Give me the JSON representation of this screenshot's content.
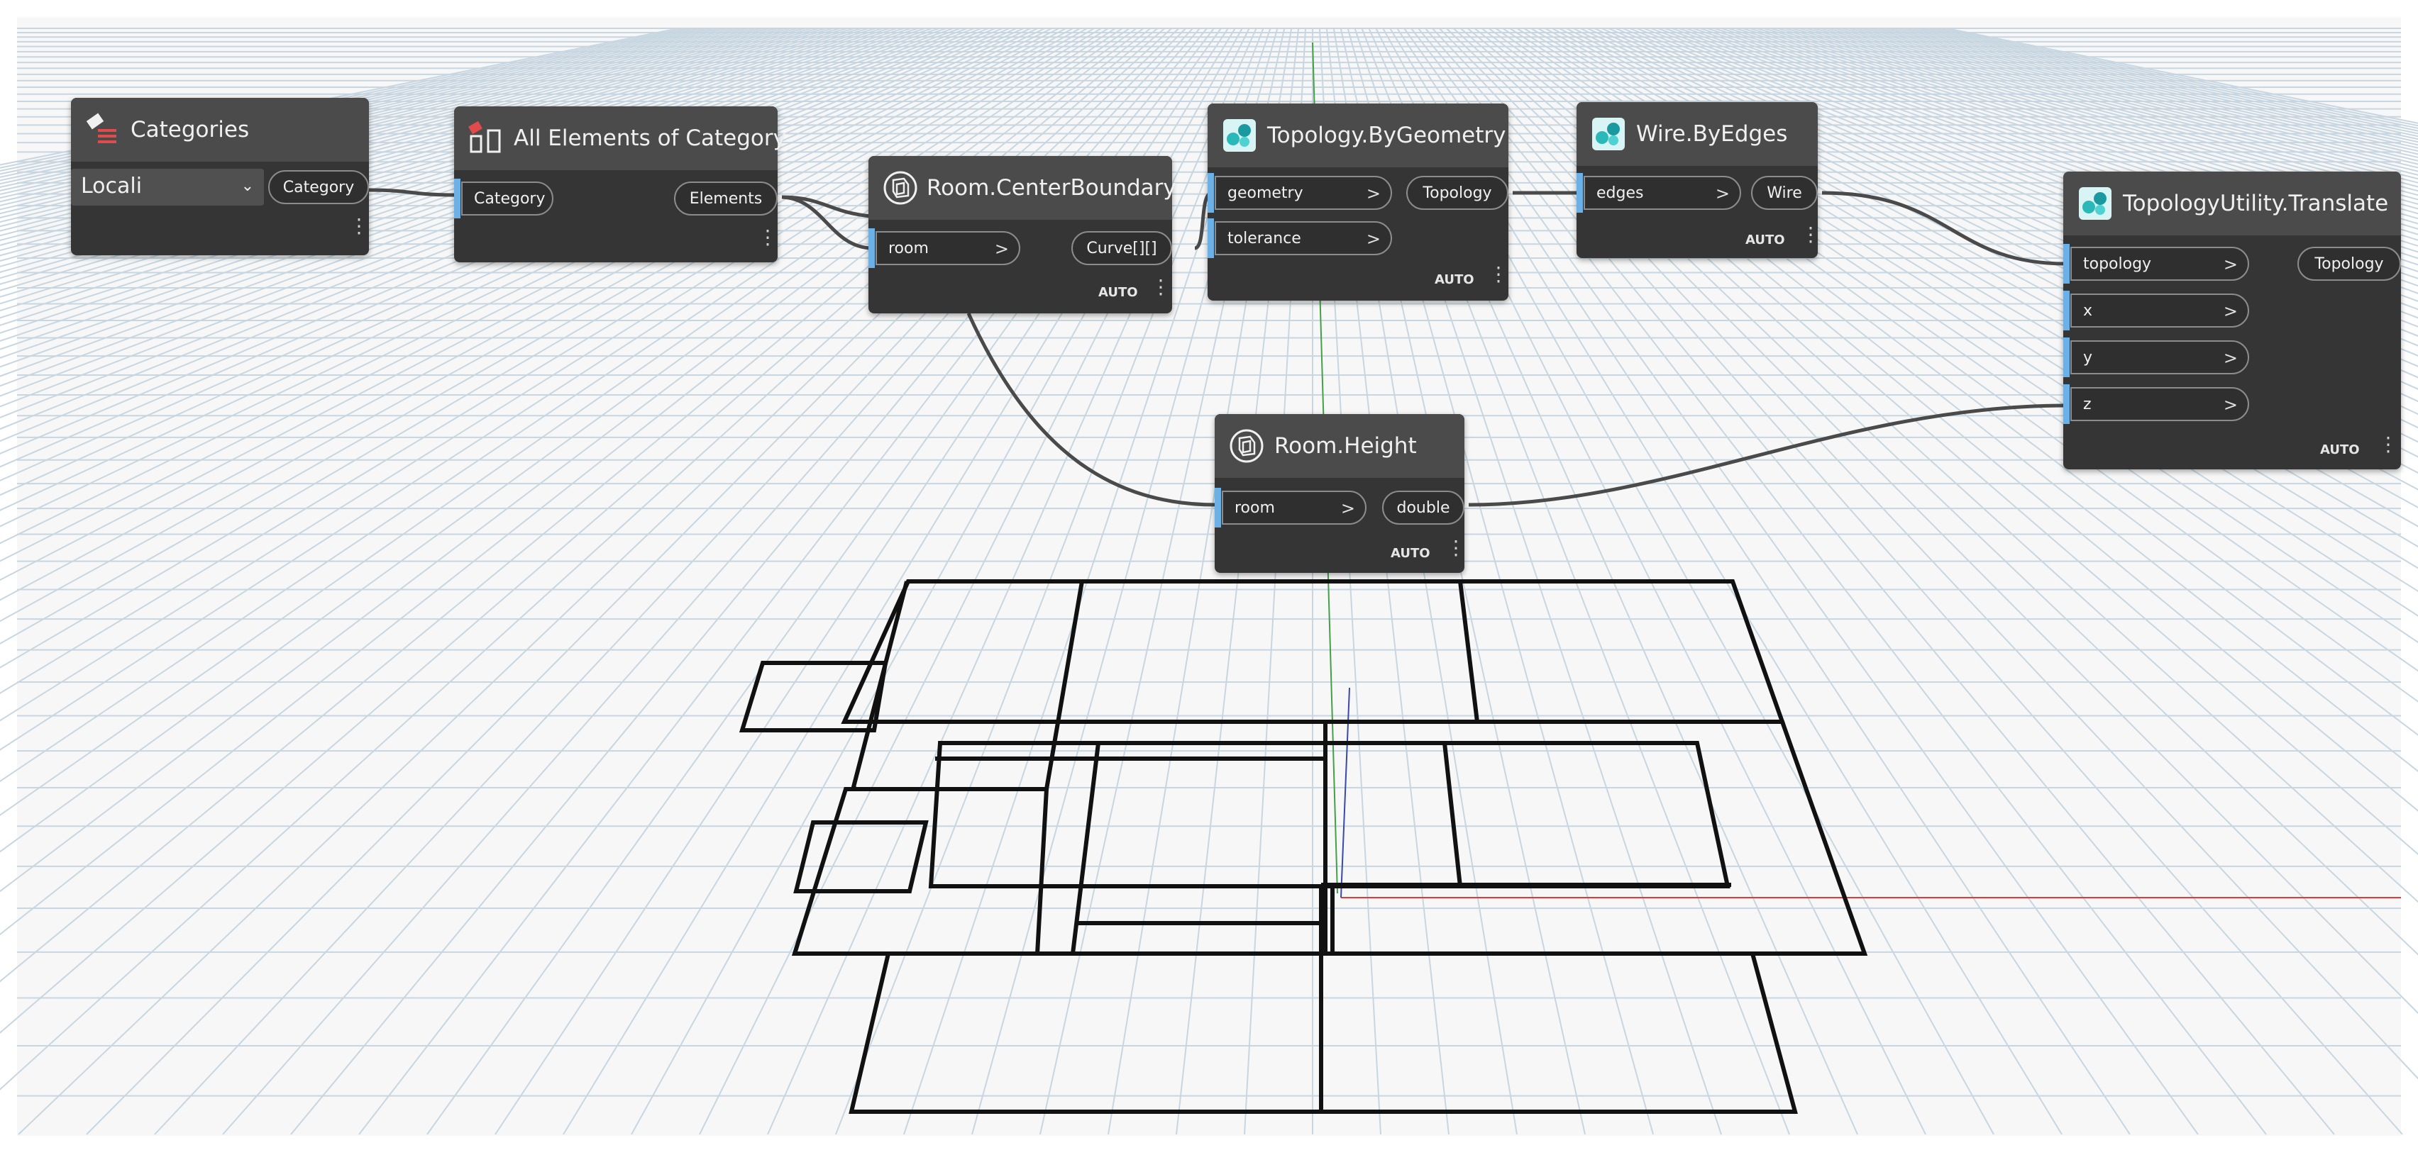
{
  "graph": {
    "nodes": {
      "categories": {
        "title": "Categories",
        "dropdown_value": "Locali",
        "output": "Category"
      },
      "all_elements": {
        "title": "All Elements of Category",
        "input": "Category",
        "output": "Elements"
      },
      "center_boundary": {
        "title": "Room.CenterBoundary",
        "input": "room",
        "output": "Curve[][]",
        "lacing": "AUTO"
      },
      "topology_by_geometry": {
        "title": "Topology.ByGeometry",
        "inputs": [
          "geometry",
          "tolerance"
        ],
        "output": "Topology",
        "lacing": "AUTO"
      },
      "wire_by_edges": {
        "title": "Wire.ByEdges",
        "input": "edges",
        "output": "Wire",
        "lacing": "AUTO"
      },
      "topology_translate": {
        "title": "TopologyUtility.Translate",
        "inputs": [
          "topology",
          "x",
          "y",
          "z"
        ],
        "output": "Topology",
        "lacing": "AUTO"
      },
      "room_height": {
        "title": "Room.Height",
        "input": "room",
        "output": "double",
        "lacing": "AUTO"
      }
    }
  },
  "icons": {
    "categories": "category-tag-icon",
    "all_elements": "element-collection-icon",
    "room": "room-icon",
    "topology": "topologic-cube-icon"
  },
  "colors": {
    "node_body": "#353535",
    "node_header": "#4b4b4b",
    "input_marker": "#6cb0e6",
    "wire": "#4a4a4a",
    "grid": "#c7d6e0",
    "axis_x": "#e53935",
    "axis_y": "#43a047",
    "axis_z": "#3949ab"
  }
}
